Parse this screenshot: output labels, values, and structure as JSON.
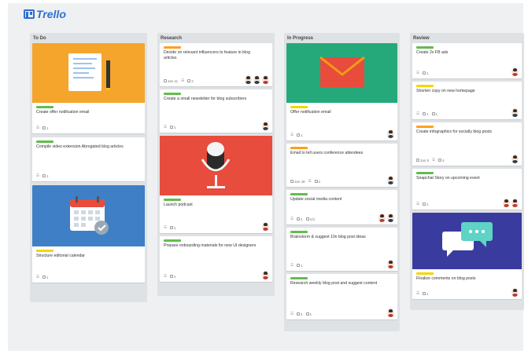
{
  "app": {
    "name": "Trello"
  },
  "colors": {
    "green": "#61bd4f",
    "yellow": "#f2d600",
    "orange": "#ff9f1a",
    "cover_orange": "#f5a52b",
    "cover_blue": "#3e7fc5",
    "cover_red": "#e74c3c",
    "cover_green": "#26a97a",
    "cover_indigo": "#3a3b9e"
  },
  "lists": [
    {
      "title": "To Do",
      "cards": [
        {
          "cover": "notebook-illustration",
          "label": "green",
          "title": "Create offer notification email",
          "badges": [
            "☰",
            "1"
          ],
          "avatars": []
        },
        {
          "cover": null,
          "label": "green",
          "title": "Compile video extension Abrogated blog articles",
          "badges": [
            "☰",
            "1"
          ],
          "avatars": []
        },
        {
          "cover": "calendar-illustration",
          "label": "yellow",
          "title": "Structure editorial calendar",
          "badges": [
            "☰",
            "1"
          ],
          "avatars": []
        }
      ]
    },
    {
      "title": "Research",
      "cards": [
        {
          "cover": null,
          "label": "orange",
          "title": "Decide on relevant influencers to feature in blog articles",
          "badges": [
            "Jan 11",
            "☰",
            "2"
          ],
          "avatars": [
            "dark",
            "dark",
            "red"
          ]
        },
        {
          "cover": null,
          "label": "green",
          "title": "Create a small newsletter for blog subscribers",
          "badges": [
            "☰",
            "1"
          ],
          "avatars": [
            "dark"
          ]
        },
        {
          "cover": "microphone-illustration",
          "label": "green",
          "title": "Launch podcast",
          "badges": [
            "☰",
            "1"
          ],
          "avatars": [
            "red"
          ]
        },
        {
          "cover": null,
          "label": "green",
          "title": "Prepare onboarding materials for new UI designers",
          "badges": [
            "☰",
            "1"
          ],
          "avatars": [
            "red"
          ]
        }
      ]
    },
    {
      "title": "In Progress",
      "cards": [
        {
          "cover": "envelope-illustration",
          "label": "yellow",
          "title": "Offer notification email",
          "badges": [
            "☰",
            "1"
          ],
          "avatars": [
            "dark"
          ]
        },
        {
          "cover": null,
          "label": "orange",
          "title": "Email to tell users conference attendees",
          "badges": [
            "Jan 28",
            "☰",
            "2"
          ],
          "avatars": [
            "dark"
          ]
        },
        {
          "cover": null,
          "label": "green",
          "title": "Update social media content",
          "badges": [
            "☰",
            "2",
            "1/3"
          ],
          "avatars": [
            "red",
            "dark"
          ]
        },
        {
          "cover": null,
          "label": "green",
          "title": "Brainstorm & suggest 10x blog post ideas",
          "badges": [
            "☰",
            "1"
          ],
          "avatars": [
            "red"
          ]
        },
        {
          "cover": null,
          "label": "green",
          "title": "Research weekly blog post and suggest content",
          "badges": [
            "☰",
            "2",
            "1"
          ],
          "avatars": [
            "red"
          ]
        }
      ]
    },
    {
      "title": "Review",
      "cards": [
        {
          "cover": null,
          "label": "green",
          "title": "Create 2x FB ads",
          "badges": [
            "☰",
            "1"
          ],
          "avatars": [
            "red"
          ]
        },
        {
          "cover": null,
          "label": "yellow",
          "title": "Shorten copy on new homepage",
          "badges": [
            "☰",
            "1",
            "1"
          ],
          "avatars": [
            "dark"
          ]
        },
        {
          "cover": null,
          "label": "orange",
          "title": "Create infographics for socially blog posts",
          "badges": [
            "Jan 8",
            "☰",
            "4"
          ],
          "avatars": [
            "dark"
          ]
        },
        {
          "cover": null,
          "label": "green",
          "title": "Snapchat Story on upcoming event",
          "badges": [
            "☰",
            "1"
          ],
          "avatars": [
            "red",
            "red"
          ]
        },
        {
          "cover": "chat-bubbles-illustration",
          "label": "yellow",
          "title": "Finalize comments on blog posts",
          "badges": [
            "☰",
            "1"
          ],
          "avatars": [
            "red"
          ]
        }
      ]
    }
  ]
}
